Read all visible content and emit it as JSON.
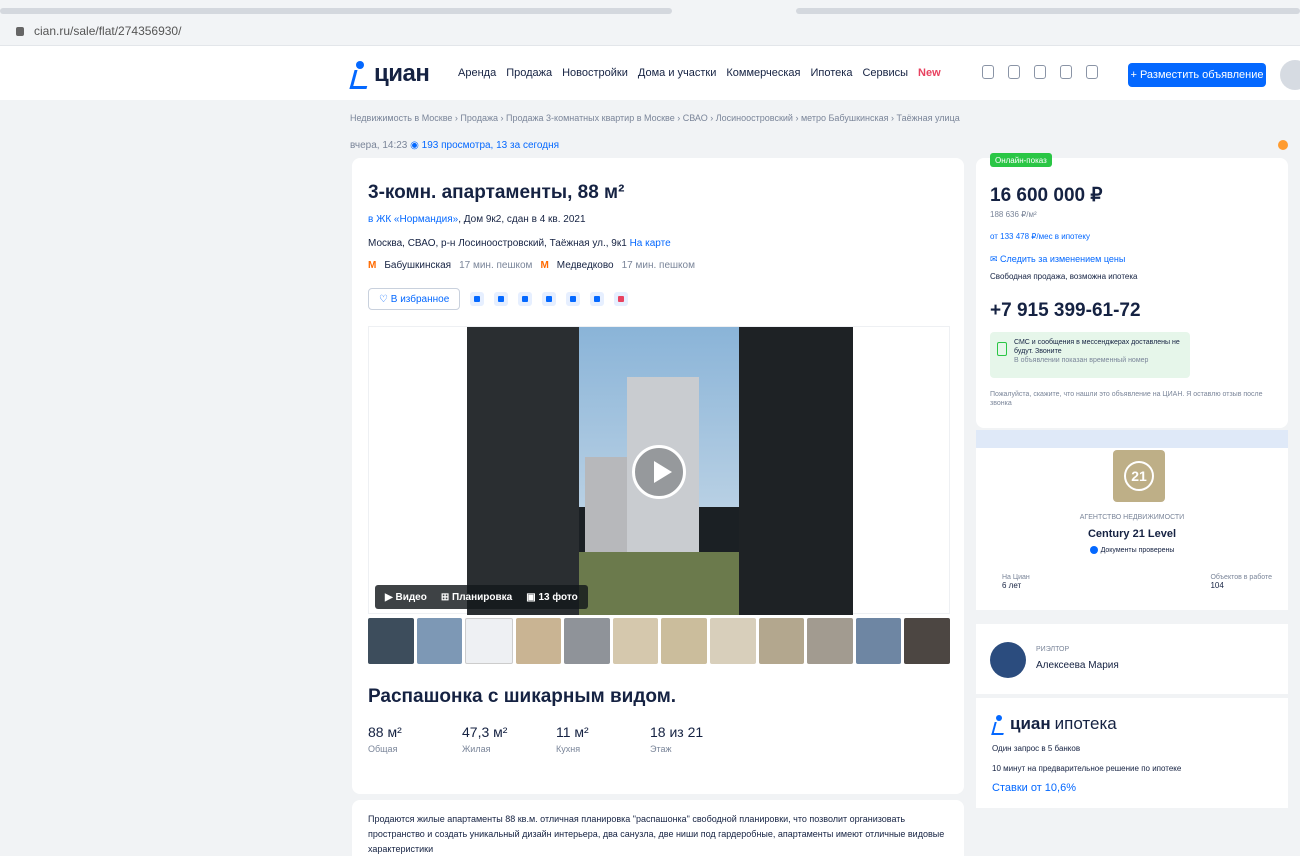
{
  "browser": {
    "url": "cian.ru/sale/flat/274356930/"
  },
  "header": {
    "logo": "циан",
    "nav": [
      "Аренда",
      "Продажа",
      "Новостройки",
      "Дома и участки",
      "Коммерческая",
      "Ипотека",
      "Сервисы",
      "New"
    ],
    "post_button": "+ Разместить объявление"
  },
  "breadcrumb": "Недвижимость в Москве  ›  Продажа  ›  Продажа 3-комнатных квартир в Москве  ›  СВАО  ›  Лосиноостровский  ›  метро Бабушкинская  ›  Таёжная улица",
  "meta": {
    "date": "вчера, 14:23",
    "views": "193 просмотра, 13 за сегодня"
  },
  "listing": {
    "title": "3-комн. апартаменты, 88 м²",
    "complex_link": "в ЖК «Нормандия»",
    "complex_rest": ", Дом 9к2, сдан в 4 кв. 2021",
    "address": "Москва, СВАО, р-н Лосиноостровский, Таёжная ул., 9к1",
    "map_link": "На карте",
    "metro": [
      {
        "name": "Бабушкинская",
        "time": "17 мин. пешком"
      },
      {
        "name": "Медведково",
        "time": "17 мин. пешком"
      }
    ],
    "favorite_button": "♡ В избранное",
    "media": {
      "video": "▶ Видео",
      "plan": "⊞ Планировка",
      "photos": "▣ 13 фото"
    },
    "headline": "Распашонка с шикарным видом.",
    "stats": [
      {
        "value": "88 м²",
        "label": "Общая"
      },
      {
        "value": "47,3 м²",
        "label": "Жилая"
      },
      {
        "value": "11 м²",
        "label": "Кухня"
      },
      {
        "value": "18 из 21",
        "label": "Этаж"
      }
    ],
    "description": "Продаются жилые апартаменты 88 кв.м. отличная планировка \"распашонка\" свободной планировки, что позволит организовать пространство и создать уникальный дизайн интерьера, два санузла, две ниши под гардеробные, апартаменты имеют отличные видовые характеристики"
  },
  "sidebar": {
    "online_badge": "Онлайн-показ",
    "price": "16 600 000 ₽",
    "price_per_m2": "188 636 ₽/м²",
    "mortgage": "от 133 478 ₽/мес в ипотеку",
    "follow_price": "Следить за изменением цены",
    "sale_type": "Свободная продажа, возможна ипотека",
    "phone": "+7 915 399-61-72",
    "sms_title": "СМС и сообщения в мессенджерах доставлены не будут. Звоните",
    "sms_sub": "В объявлении показан временный номер",
    "notice": "Пожалуйста, скажите, что нашли это объявление на ЦИАН. Я оставлю отзыв после звонка",
    "agency": {
      "logo_text": "21",
      "label": "АГЕНТСТВО НЕДВИЖИМОСТИ",
      "name": "Century 21 Level",
      "verified": "Документы проверены",
      "stat1_label": "На Циан",
      "stat1_value": "6 лет",
      "stat2_label": "Объектов в работе",
      "stat2_value": "104"
    },
    "realtor": {
      "label": "РИЭЛТОР",
      "name": "Алексеева Мария"
    },
    "ipoteka": {
      "brand": "циан",
      "word": "ипотека",
      "line1": "Один запрос в 5 банков",
      "line2": "10 минут на предварительное решение по ипотеке",
      "rate": "Ставки от 10,6%"
    }
  },
  "colors": {
    "accent": "#0468ff",
    "metro": "#ff6a00",
    "online": "#2ac645"
  }
}
